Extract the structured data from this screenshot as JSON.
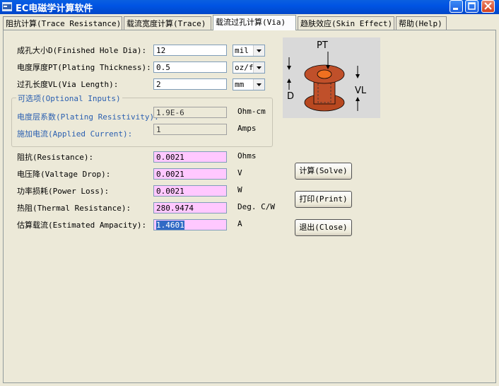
{
  "window": {
    "title": "EC电磁学计算软件"
  },
  "tabs": [
    {
      "label": "阻抗计算(Trace Resistance)"
    },
    {
      "label": "载流宽度计算(Trace)"
    },
    {
      "label": "载流过孔计算(Via)"
    },
    {
      "label": "趋肤效应(Skin Effect)"
    },
    {
      "label": "帮助(Help)"
    }
  ],
  "inputs": {
    "finished_hole_dia": {
      "label": "成孔大小D(Finished Hole Dia):",
      "value": "12",
      "unit": "mil"
    },
    "plating_thickness": {
      "label": "电度厚度PT(Plating Thickness):",
      "value": "0.5",
      "unit": "oz/ft"
    },
    "via_length": {
      "label": "过孔长度VL(Via Length):",
      "value": "2",
      "unit": "mm"
    }
  },
  "optional": {
    "title": "可选项(Optional Inputs)",
    "resistivity": {
      "label": "电度层系数(Plating Resistivity):",
      "value": "1.9E-6",
      "unit": "Ohm-cm"
    },
    "current": {
      "label": "施加电流(Applied Current):",
      "value": "1",
      "unit": "Amps"
    }
  },
  "results": {
    "resistance": {
      "label": "阻抗(Resistance):",
      "value": "0.0021",
      "unit": "Ohms"
    },
    "voltage_drop": {
      "label": "电压降(Valtage Drop):",
      "value": "0.0021",
      "unit": "V"
    },
    "power_loss": {
      "label": "功率损耗(Power Loss):",
      "value": "0.0021",
      "unit": "W"
    },
    "thermal_resistance": {
      "label": "热阻(Thermal Resistance):",
      "value": "280.9474",
      "unit": "Deg. C/W"
    },
    "ampacity": {
      "label": "估算载流(Estimated Ampacity):",
      "value": "1.4601",
      "unit": "A"
    }
  },
  "buttons": {
    "solve": "计算(Solve)",
    "print": "打印(Print)",
    "close": "退出(Close)"
  },
  "diagram": {
    "pt": "PT",
    "d": "D",
    "vl": "VL"
  },
  "colors": {
    "title_bar": "#0054e3",
    "result_bg": "#ffc8ff",
    "label_blue": "#2a5fb0",
    "via_copper": "#c0502a",
    "via_ring": "#f07020"
  }
}
